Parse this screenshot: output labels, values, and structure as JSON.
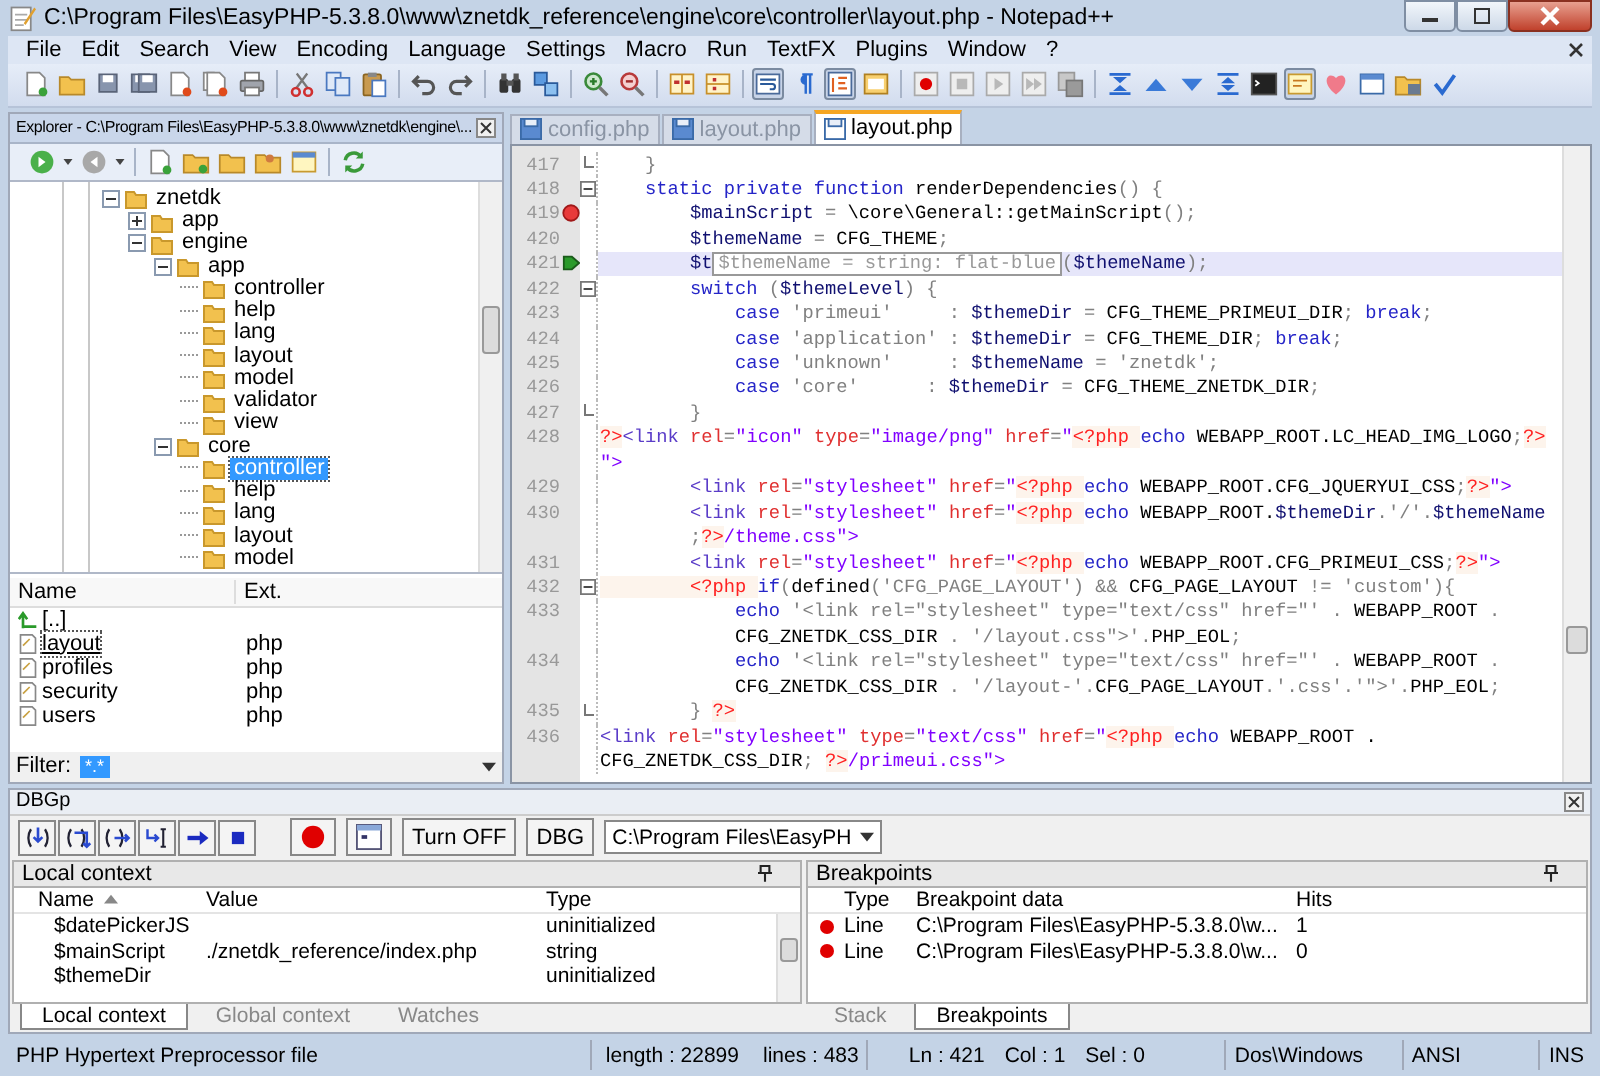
{
  "window": {
    "title": "C:\\Program Files\\EasyPHP-5.3.8.0\\www\\znetdk_reference\\engine\\core\\controller\\layout.php - Notepad++"
  },
  "menu": [
    "File",
    "Edit",
    "Search",
    "View",
    "Encoding",
    "Language",
    "Settings",
    "Macro",
    "Run",
    "TextFX",
    "Plugins",
    "Window",
    "?"
  ],
  "toolbar": {
    "toggles": [
      {
        "pressed": false
      },
      {
        "pressed": false
      },
      {
        "pressed": true
      },
      {
        "pressed": false
      },
      {
        "pressed": true
      },
      {
        "pressed": false
      },
      {
        "pressed": true
      },
      {
        "pressed": false
      }
    ]
  },
  "explorer": {
    "title": "Explorer - C:\\Program Files\\EasyPHP-5.3.8.0\\www\\znetdk\\engine\\...",
    "tree": [
      {
        "label": "znetdk",
        "expanded": true,
        "selected": false,
        "children": [
          {
            "label": "app",
            "expanded": false,
            "selected": false
          },
          {
            "label": "engine",
            "expanded": true,
            "selected": false,
            "children": [
              {
                "label": "app",
                "expanded": true,
                "selected": false,
                "children": [
                  {
                    "label": "controller",
                    "selected": false
                  },
                  {
                    "label": "help",
                    "selected": false
                  },
                  {
                    "label": "lang",
                    "selected": false
                  },
                  {
                    "label": "layout",
                    "selected": false
                  },
                  {
                    "label": "model",
                    "selected": false
                  },
                  {
                    "label": "validator",
                    "selected": false
                  },
                  {
                    "label": "view",
                    "selected": false
                  }
                ]
              },
              {
                "label": "core",
                "expanded": true,
                "selected": false,
                "children": [
                  {
                    "label": "controller",
                    "selected": true
                  },
                  {
                    "label": "help",
                    "selected": false
                  },
                  {
                    "label": "lang",
                    "selected": false
                  },
                  {
                    "label": "layout",
                    "selected": false
                  },
                  {
                    "label": "model",
                    "selected": false
                  }
                ]
              }
            ]
          }
        ]
      }
    ],
    "files": {
      "columns": [
        "Name",
        "Ext."
      ],
      "rows": [
        {
          "kind": "parent",
          "name": "[..]",
          "selected": false
        },
        {
          "kind": "file",
          "name": "layout",
          "ext": "php",
          "selected": true
        },
        {
          "kind": "file",
          "name": "profiles",
          "ext": "php",
          "selected": false
        },
        {
          "kind": "file",
          "name": "security",
          "ext": "php",
          "selected": false
        },
        {
          "kind": "file",
          "name": "users",
          "ext": "php",
          "selected": false
        }
      ]
    },
    "filter": {
      "label": "Filter:",
      "value": "*.*"
    }
  },
  "editor": {
    "tabs": [
      {
        "label": "config.php",
        "selected": false
      },
      {
        "label": "layout.php",
        "selected": false
      },
      {
        "label": "layout.php",
        "selected": true
      }
    ],
    "lines": [
      {
        "number": "417",
        "kind": "fold-end",
        "breakpoint": false,
        "current": false,
        "rows": [
          {
            "segments": [
              {
                "kind": "o",
                "text": "    }"
              }
            ]
          }
        ]
      },
      {
        "number": "418",
        "kind": "fold-start",
        "breakpoint": false,
        "current": false,
        "rows": [
          {
            "segments": [
              {
                "kind": "kw",
                "text": "    static private function"
              },
              {
                "kind": "p",
                "text": " renderDependencies"
              },
              {
                "kind": "o",
                "text": "() {"
              }
            ]
          }
        ]
      },
      {
        "number": "419",
        "kind": "plain",
        "breakpoint": true,
        "current": false,
        "rows": [
          {
            "segments": [
              {
                "kind": "v",
                "text": "        $mainScript"
              },
              {
                "kind": "o",
                "text": " = "
              },
              {
                "kind": "p",
                "text": "\\core\\General::getMainScript"
              },
              {
                "kind": "o",
                "text": "();"
              }
            ]
          }
        ]
      },
      {
        "number": "420",
        "kind": "plain",
        "breakpoint": false,
        "current": false,
        "rows": [
          {
            "segments": [
              {
                "kind": "v",
                "text": "        $themeName"
              },
              {
                "kind": "o",
                "text": " = "
              },
              {
                "kind": "p",
                "text": "CFG_THEME"
              },
              {
                "kind": "o",
                "text": ";"
              }
            ]
          }
        ]
      },
      {
        "number": "421",
        "kind": "plain",
        "breakpoint": false,
        "current": true,
        "rows": [
          {
            "segments": [
              {
                "kind": "v",
                "text": "        $t"
              },
              {
                "kind": "tip",
                "text": "$themeName = string: flat-blue"
              },
              {
                "kind": "o",
                "text": "("
              },
              {
                "kind": "v",
                "text": "$themeName"
              },
              {
                "kind": "o",
                "text": ");"
              }
            ]
          }
        ]
      },
      {
        "number": "422",
        "kind": "fold-start",
        "breakpoint": false,
        "current": false,
        "rows": [
          {
            "segments": [
              {
                "kind": "kw",
                "text": "        switch"
              },
              {
                "kind": "o",
                "text": " ("
              },
              {
                "kind": "v",
                "text": "$themeLevel"
              },
              {
                "kind": "o",
                "text": ") {"
              }
            ]
          }
        ]
      },
      {
        "number": "423",
        "kind": "plain",
        "breakpoint": false,
        "current": false,
        "rows": [
          {
            "segments": [
              {
                "kind": "kw",
                "text": "            case "
              },
              {
                "kind": "s",
                "text": "'primeui'     "
              },
              {
                "kind": "o",
                "text": ": "
              },
              {
                "kind": "v",
                "text": "$themeDir"
              },
              {
                "kind": "o",
                "text": " = "
              },
              {
                "kind": "p",
                "text": "CFG_THEME_PRIMEUI_DIR"
              },
              {
                "kind": "o",
                "text": "; "
              },
              {
                "kind": "kw",
                "text": "break"
              },
              {
                "kind": "o",
                "text": ";"
              }
            ]
          }
        ]
      },
      {
        "number": "424",
        "kind": "plain",
        "breakpoint": false,
        "current": false,
        "rows": [
          {
            "segments": [
              {
                "kind": "kw",
                "text": "            case "
              },
              {
                "kind": "s",
                "text": "'application' "
              },
              {
                "kind": "o",
                "text": ": "
              },
              {
                "kind": "v",
                "text": "$themeDir"
              },
              {
                "kind": "o",
                "text": " = "
              },
              {
                "kind": "p",
                "text": "CFG_THEME_DIR"
              },
              {
                "kind": "o",
                "text": "; "
              },
              {
                "kind": "kw",
                "text": "break"
              },
              {
                "kind": "o",
                "text": ";"
              }
            ]
          }
        ]
      },
      {
        "number": "425",
        "kind": "plain",
        "breakpoint": false,
        "current": false,
        "rows": [
          {
            "segments": [
              {
                "kind": "kw",
                "text": "            case "
              },
              {
                "kind": "s",
                "text": "'unknown'     "
              },
              {
                "kind": "o",
                "text": ": "
              },
              {
                "kind": "v",
                "text": "$themeName"
              },
              {
                "kind": "o",
                "text": " = "
              },
              {
                "kind": "s",
                "text": "'znetdk'"
              },
              {
                "kind": "o",
                "text": ";"
              }
            ]
          }
        ]
      },
      {
        "number": "426",
        "kind": "plain",
        "breakpoint": false,
        "current": false,
        "rows": [
          {
            "segments": [
              {
                "kind": "kw",
                "text": "            case "
              },
              {
                "kind": "s",
                "text": "'core'      "
              },
              {
                "kind": "o",
                "text": ": "
              },
              {
                "kind": "v",
                "text": "$themeDir"
              },
              {
                "kind": "o",
                "text": " = "
              },
              {
                "kind": "p",
                "text": "CFG_THEME_ZNETDK_DIR"
              },
              {
                "kind": "o",
                "text": ";"
              }
            ]
          }
        ]
      },
      {
        "number": "427",
        "kind": "fold-end",
        "breakpoint": false,
        "current": false,
        "rows": [
          {
            "segments": [
              {
                "kind": "o",
                "text": "        }"
              }
            ]
          }
        ]
      },
      {
        "number": "428",
        "kind": "plain",
        "breakpoint": false,
        "current": false,
        "rows": [
          {
            "segments": [
              {
                "kind": "pt",
                "text": "?>"
              },
              {
                "kind": "t",
                "text": "<link "
              },
              {
                "kind": "a",
                "text": "rel"
              },
              {
                "kind": "o",
                "text": "="
              },
              {
                "kind": "av",
                "text": "\"icon\" "
              },
              {
                "kind": "a",
                "text": "type"
              },
              {
                "kind": "o",
                "text": "="
              },
              {
                "kind": "av",
                "text": "\"image/png\" "
              },
              {
                "kind": "a",
                "text": "href"
              },
              {
                "kind": "o",
                "text": "="
              },
              {
                "kind": "av",
                "text": "\""
              },
              {
                "kind": "pt",
                "text": "<?php "
              },
              {
                "kind": "kw",
                "text": "echo"
              },
              {
                "kind": "p",
                "text": " WEBAPP_ROOT.LC_HEAD_IMG_LOGO"
              },
              {
                "kind": "o",
                "text": ";"
              },
              {
                "kind": "pt",
                "text": "?>"
              }
            ]
          },
          {
            "segments": [
              {
                "kind": "av",
                "text": "\">"
              }
            ]
          }
        ]
      },
      {
        "number": "429",
        "kind": "plain",
        "breakpoint": false,
        "current": false,
        "rows": [
          {
            "segments": [
              {
                "kind": "t",
                "text": "        <link "
              },
              {
                "kind": "a",
                "text": "rel"
              },
              {
                "kind": "o",
                "text": "="
              },
              {
                "kind": "av",
                "text": "\"stylesheet\" "
              },
              {
                "kind": "a",
                "text": "href"
              },
              {
                "kind": "o",
                "text": "="
              },
              {
                "kind": "av",
                "text": "\""
              },
              {
                "kind": "pt",
                "text": "<?php "
              },
              {
                "kind": "kw",
                "text": "echo"
              },
              {
                "kind": "p",
                "text": " WEBAPP_ROOT.CFG_JQUERYUI_CSS"
              },
              {
                "kind": "o",
                "text": ";"
              },
              {
                "kind": "pt",
                "text": "?>"
              },
              {
                "kind": "av",
                "text": "\">"
              }
            ]
          }
        ]
      },
      {
        "number": "430",
        "kind": "plain",
        "breakpoint": false,
        "current": false,
        "rows": [
          {
            "segments": [
              {
                "kind": "t",
                "text": "        <link "
              },
              {
                "kind": "a",
                "text": "rel"
              },
              {
                "kind": "o",
                "text": "="
              },
              {
                "kind": "av",
                "text": "\"stylesheet\" "
              },
              {
                "kind": "a",
                "text": "href"
              },
              {
                "kind": "o",
                "text": "="
              },
              {
                "kind": "av",
                "text": "\""
              },
              {
                "kind": "pt",
                "text": "<?php "
              },
              {
                "kind": "kw",
                "text": "echo"
              },
              {
                "kind": "p",
                "text": " WEBAPP_ROOT."
              },
              {
                "kind": "v",
                "text": "$themeDir"
              },
              {
                "kind": "o",
                "text": "."
              },
              {
                "kind": "s",
                "text": "'/'"
              },
              {
                "kind": "o",
                "text": "."
              },
              {
                "kind": "v",
                "text": "$themeName"
              }
            ]
          },
          {
            "segments": [
              {
                "kind": "o",
                "text": "        ;"
              },
              {
                "kind": "pt",
                "text": "?>"
              },
              {
                "kind": "av",
                "text": "/theme.css\">"
              }
            ]
          }
        ]
      },
      {
        "number": "431",
        "kind": "plain",
        "breakpoint": false,
        "current": false,
        "rows": [
          {
            "segments": [
              {
                "kind": "t",
                "text": "        <link "
              },
              {
                "kind": "a",
                "text": "rel"
              },
              {
                "kind": "o",
                "text": "="
              },
              {
                "kind": "av",
                "text": "\"stylesheet\" "
              },
              {
                "kind": "a",
                "text": "href"
              },
              {
                "kind": "o",
                "text": "="
              },
              {
                "kind": "av",
                "text": "\""
              },
              {
                "kind": "pt",
                "text": "<?php "
              },
              {
                "kind": "kw",
                "text": "echo"
              },
              {
                "kind": "p",
                "text": " WEBAPP_ROOT.CFG_PRIMEUI_CSS"
              },
              {
                "kind": "o",
                "text": ";"
              },
              {
                "kind": "pt",
                "text": "?>"
              },
              {
                "kind": "av",
                "text": "\">"
              }
            ]
          }
        ]
      },
      {
        "number": "432",
        "kind": "fold-start",
        "breakpoint": false,
        "current": false,
        "rows": [
          {
            "segments": [
              {
                "kind": "pt",
                "text": "        <?php "
              },
              {
                "kind": "kw",
                "text": "if"
              },
              {
                "kind": "o",
                "text": "("
              },
              {
                "kind": "p",
                "text": "defined"
              },
              {
                "kind": "o",
                "text": "("
              },
              {
                "kind": "s",
                "text": "'CFG_PAGE_LAYOUT'"
              },
              {
                "kind": "o",
                "text": ") && "
              },
              {
                "kind": "p",
                "text": "CFG_PAGE_LAYOUT"
              },
              {
                "kind": "o",
                "text": " != "
              },
              {
                "kind": "s",
                "text": "'custom'"
              },
              {
                "kind": "o",
                "text": "){"
              }
            ]
          }
        ]
      },
      {
        "number": "433",
        "kind": "plain",
        "breakpoint": false,
        "current": false,
        "rows": [
          {
            "segments": [
              {
                "kind": "kw",
                "text": "            echo "
              },
              {
                "kind": "s",
                "text": "'<link rel=\"stylesheet\" type=\"text/css\" href=\"'"
              },
              {
                "kind": "o",
                "text": " . "
              },
              {
                "kind": "p",
                "text": "WEBAPP_ROOT"
              },
              {
                "kind": "o",
                "text": " ."
              }
            ]
          },
          {
            "segments": [
              {
                "kind": "p",
                "text": "            CFG_ZNETDK_CSS_DIR"
              },
              {
                "kind": "o",
                "text": " . "
              },
              {
                "kind": "s",
                "text": "'/layout.css\">'"
              },
              {
                "kind": "o",
                "text": "."
              },
              {
                "kind": "p",
                "text": "PHP_EOL"
              },
              {
                "kind": "o",
                "text": ";"
              }
            ]
          }
        ]
      },
      {
        "number": "434",
        "kind": "plain",
        "breakpoint": false,
        "current": false,
        "rows": [
          {
            "segments": [
              {
                "kind": "kw",
                "text": "            echo "
              },
              {
                "kind": "s",
                "text": "'<link rel=\"stylesheet\" type=\"text/css\" href=\"'"
              },
              {
                "kind": "o",
                "text": " . "
              },
              {
                "kind": "p",
                "text": "WEBAPP_ROOT"
              },
              {
                "kind": "o",
                "text": " ."
              }
            ]
          },
          {
            "segments": [
              {
                "kind": "p",
                "text": "            CFG_ZNETDK_CSS_DIR"
              },
              {
                "kind": "o",
                "text": " . "
              },
              {
                "kind": "s",
                "text": "'/layout-'"
              },
              {
                "kind": "o",
                "text": "."
              },
              {
                "kind": "p",
                "text": "CFG_PAGE_LAYOUT"
              },
              {
                "kind": "o",
                "text": "."
              },
              {
                "kind": "s",
                "text": "'.css'"
              },
              {
                "kind": "o",
                "text": "."
              },
              {
                "kind": "s",
                "text": "'\">'"
              },
              {
                "kind": "o",
                "text": "."
              },
              {
                "kind": "p",
                "text": "PHP_EOL"
              },
              {
                "kind": "o",
                "text": ";"
              }
            ]
          }
        ]
      },
      {
        "number": "435",
        "kind": "fold-end",
        "breakpoint": false,
        "current": false,
        "rows": [
          {
            "segments": [
              {
                "kind": "o",
                "text": "        } "
              },
              {
                "kind": "pt",
                "text": "?>"
              }
            ]
          }
        ]
      },
      {
        "number": "436",
        "kind": "plain",
        "breakpoint": false,
        "current": false,
        "rows": [
          {
            "segments": [
              {
                "kind": "t",
                "text": "<link "
              },
              {
                "kind": "a",
                "text": "rel"
              },
              {
                "kind": "o",
                "text": "="
              },
              {
                "kind": "av",
                "text": "\"stylesheet\" "
              },
              {
                "kind": "a",
                "text": "type"
              },
              {
                "kind": "o",
                "text": "="
              },
              {
                "kind": "av",
                "text": "\"text/css\" "
              },
              {
                "kind": "a",
                "text": "href"
              },
              {
                "kind": "o",
                "text": "="
              },
              {
                "kind": "av",
                "text": "\""
              },
              {
                "kind": "pt",
                "text": "<?php "
              },
              {
                "kind": "kw",
                "text": "echo"
              },
              {
                "kind": "p",
                "text": " WEBAPP_ROOT ."
              }
            ]
          },
          {
            "segments": [
              {
                "kind": "p",
                "text": "CFG_ZNETDK_CSS_DIR"
              },
              {
                "kind": "o",
                "text": "; "
              },
              {
                "kind": "pt",
                "text": "?>"
              },
              {
                "kind": "av",
                "text": "/primeui.css\">"
              }
            ]
          }
        ]
      }
    ]
  },
  "debugger": {
    "title": "DBGp",
    "buttons": [
      "Turn OFF",
      "DBG"
    ],
    "path_select": "C:\\Program Files\\EasyPH",
    "local_context": {
      "title": "Local context",
      "columns": [
        "Name",
        "Value",
        "Type"
      ],
      "rows": [
        {
          "name": "$datePickerJS",
          "type": "uninitialized"
        },
        {
          "name": "$mainScript",
          "value": "./znetdk_reference/index.php",
          "type": "string"
        },
        {
          "name": "$themeDir",
          "type": "uninitialized"
        }
      ],
      "tabs": [
        {
          "label": "Local context",
          "selected": true
        },
        {
          "label": "Global context",
          "selected": false
        },
        {
          "label": "Watches",
          "selected": false
        }
      ]
    },
    "breakpoints": {
      "title": "Breakpoints",
      "columns": [
        "Type",
        "Breakpoint data",
        "Hits"
      ],
      "rows": [
        {
          "type": "Line",
          "data": "C:\\Program Files\\EasyPHP-5.3.8.0\\w...",
          "hits": "1"
        },
        {
          "type": "Line",
          "data": "C:\\Program Files\\EasyPHP-5.3.8.0\\w...",
          "hits": "0"
        }
      ],
      "tabs": [
        {
          "label": "Stack",
          "selected": false
        },
        {
          "label": "Breakpoints",
          "selected": true
        }
      ]
    }
  },
  "status_bar": {
    "file_type": "PHP Hypertext Preprocessor file",
    "length": "length : 22899",
    "lines": "lines : 483",
    "ln": "Ln : 421",
    "col": "Col : 1",
    "sel": "Sel : 0",
    "eol": "Dos\\Windows",
    "encoding": "ANSI",
    "mode": "INS"
  }
}
